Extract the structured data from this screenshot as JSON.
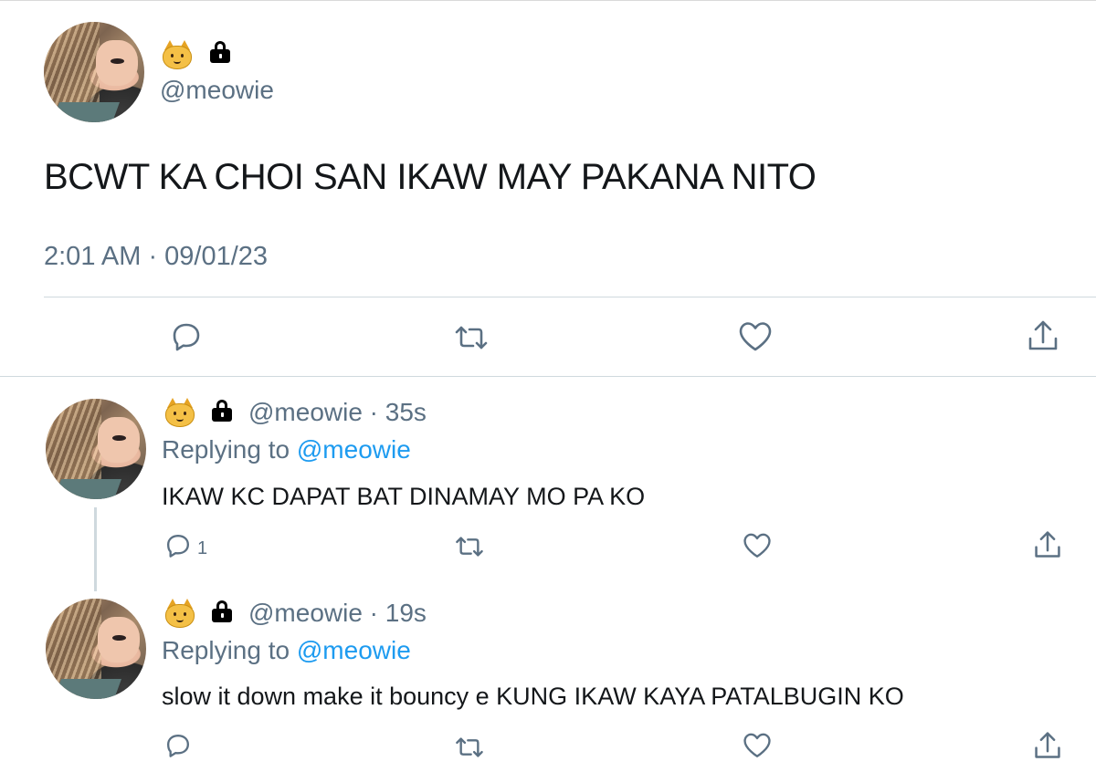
{
  "main_tweet": {
    "handle": "@meowie",
    "text": "BCWT KA CHOI SAN IKAW MAY PAKANA NITO",
    "timestamp": "2:01 AM · 09/01/23",
    "name_emojis": [
      "cat-face-icon",
      "lock-icon"
    ]
  },
  "actions": {
    "reply": "speech-bubble-icon",
    "retweet": "retweet-icon",
    "like": "heart-icon",
    "share": "share-icon"
  },
  "replies": [
    {
      "handle_time": "@meowie · 35s",
      "replying_prefix": "Replying to ",
      "replying_to": "@meowie",
      "text": "IKAW KC DAPAT BAT DINAMAY MO PA KO",
      "reply_count": "1"
    },
    {
      "handle_time": "@meowie · 19s",
      "replying_prefix": "Replying to ",
      "replying_to": "@meowie",
      "text": "slow it down make it bouncy e KUNG IKAW KAYA PATALBUGIN KO",
      "reply_count": ""
    }
  ],
  "colors": {
    "text": "#14171a",
    "secondary": "#5b7083",
    "link": "#1d9bf0",
    "divider": "#cfd9de"
  }
}
